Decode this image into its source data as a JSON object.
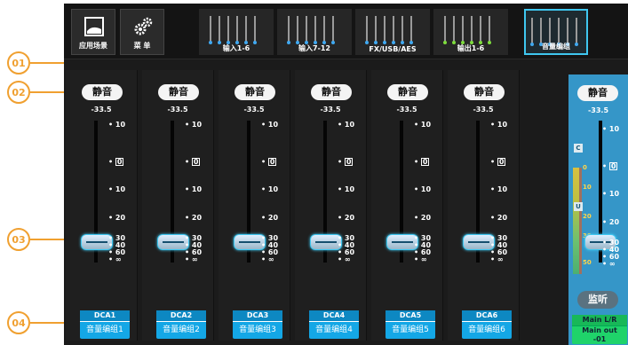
{
  "callouts": [
    "01",
    "02",
    "03",
    "04"
  ],
  "nav": {
    "scenes_label": "应用场景",
    "menu_label": "菜 单",
    "scenes_icon": "image-icon",
    "menu_icon": "gears-icon"
  },
  "banks": [
    {
      "label": "输入1-6",
      "dot_color": "#3fa8f0"
    },
    {
      "label": "输入7-12",
      "dot_color": "#3fa8f0"
    },
    {
      "label": "FX/USB/AES",
      "dot_color": "#3fa8f0"
    },
    {
      "label": "输出1-6",
      "dot_color": "#7ddc3c"
    },
    {
      "label": "音量编组",
      "dot_color": "#3fa8f0"
    }
  ],
  "strip": {
    "mute_label": "静音",
    "level": "-33.5",
    "ticks": [
      "10",
      "0",
      "10",
      "20",
      "30",
      "40",
      "60",
      "∞"
    ]
  },
  "dca_strips": [
    {
      "name": "DCA1",
      "group": "音量编组1"
    },
    {
      "name": "DCA2",
      "group": "音量编组2"
    },
    {
      "name": "DCA3",
      "group": "音量编组3"
    },
    {
      "name": "DCA4",
      "group": "音量编组4"
    },
    {
      "name": "DCA5",
      "group": "音量编组5"
    },
    {
      "name": "DCA6",
      "group": "音量编组6"
    }
  ],
  "master": {
    "mute_label": "静音",
    "level": "-33.5",
    "meter_scale": [
      "0",
      "10",
      "20",
      "30",
      "50"
    ],
    "clip_tag": "C",
    "meter_tag": "U",
    "monitor_label": "监听",
    "bus_name": "Main L/R",
    "bus_out": "Main out",
    "bus_value": "-01"
  },
  "colors": {
    "accent": "#3fc7f0",
    "callout": "#f0a030",
    "master": "#3596c8",
    "main_out": "#1fd36a"
  }
}
